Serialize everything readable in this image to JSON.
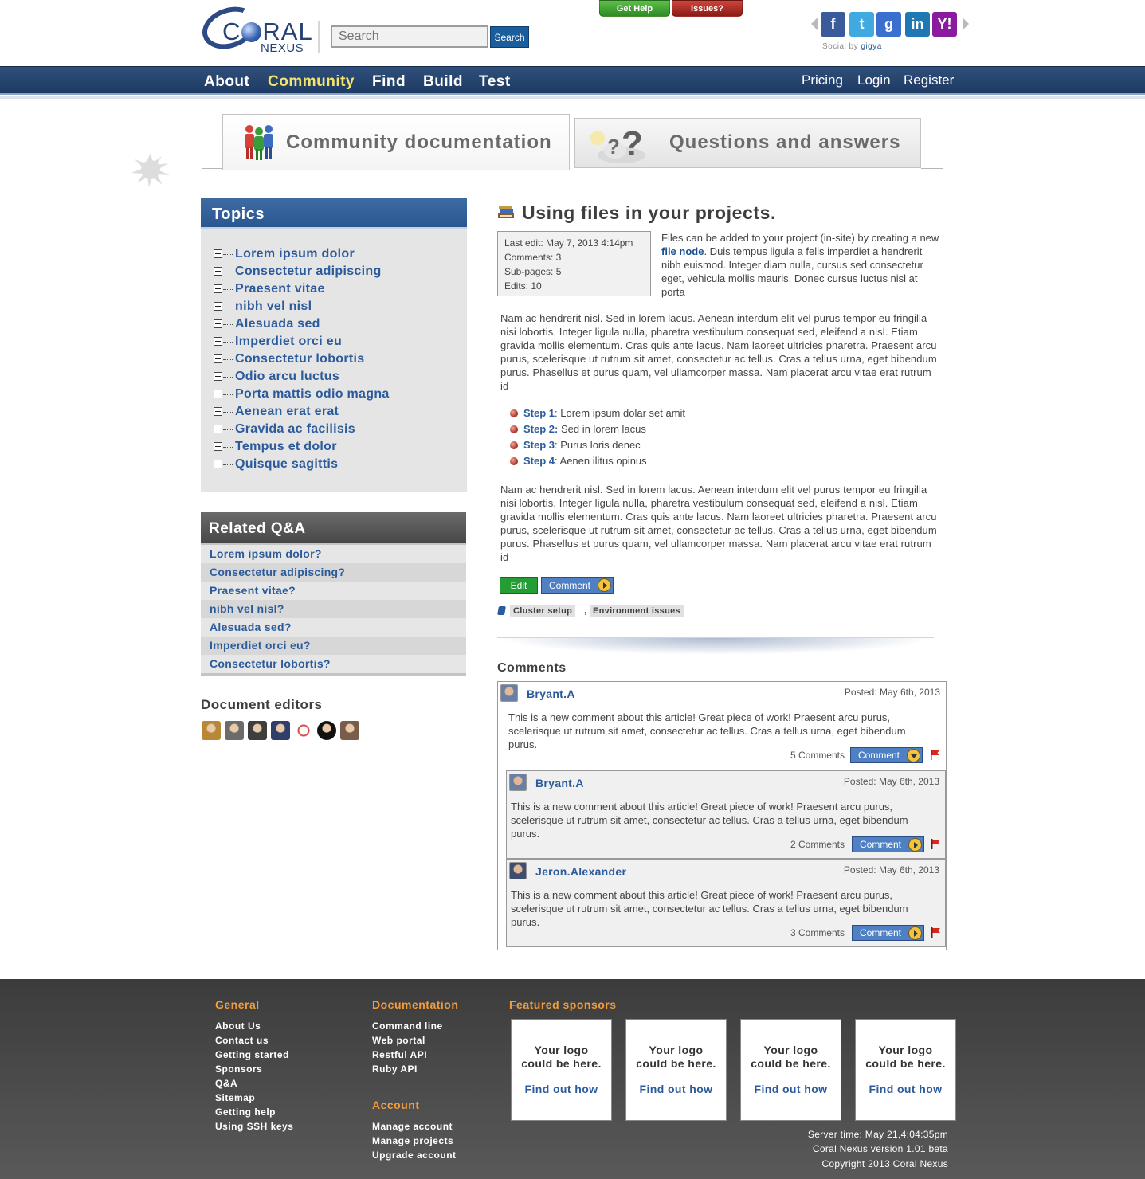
{
  "header": {
    "logo_word_a": "C",
    "logo_word_b": "RAL",
    "logo_sub": "NEXUS",
    "search_placeholder": "Search",
    "search_button": "Search",
    "get_help": "Get Help",
    "issues": "Issues?",
    "social_label": "Social by",
    "social_brand": "gigya",
    "social_icons": [
      "facebook-icon",
      "twitter-icon",
      "google-icon",
      "linkedin-icon",
      "yahoo-icon"
    ],
    "social_glyphs": [
      "f",
      "t",
      "g",
      "in",
      "Y!"
    ]
  },
  "nav": {
    "left": [
      "About",
      "Community",
      "Find",
      "Build",
      "Test"
    ],
    "active": "Community",
    "right": [
      "Pricing",
      "Login",
      "Register"
    ]
  },
  "tabs": {
    "doc": "Community documentation",
    "qa": "Questions and answers"
  },
  "topics": {
    "title": "Topics",
    "items": [
      "Lorem ipsum dolor",
      "Consectetur adipiscing",
      "Praesent vitae",
      "nibh vel nisl",
      "Alesuada sed",
      "Imperdiet orci eu",
      "Consectetur lobortis",
      "Odio arcu luctus",
      "Porta mattis odio magna",
      "Aenean erat erat",
      "Gravida ac facilisis",
      "Tempus et dolor",
      "Quisque sagittis"
    ]
  },
  "related": {
    "title": "Related Q&A",
    "items": [
      "Lorem ipsum dolor?",
      "Consectetur adipiscing?",
      "Praesent vitae?",
      "nibh vel nisl?",
      "Alesuada sed?",
      "Imperdiet orci eu?",
      "Consectetur lobortis?"
    ]
  },
  "editors": {
    "title": "Document editors",
    "colors": [
      "#b98836",
      "#6b6b6b",
      "#3e3e3e",
      "#2f3f6a",
      "#d84a4a",
      "#111111",
      "#7a5c4a"
    ]
  },
  "article": {
    "title": "Using files in your projects.",
    "meta": {
      "last_edit": "Last edit: May 7, 2013 4:14pm",
      "comments": "Comments: 3",
      "subpages": "Sub-pages: 5",
      "edits": "Edits: 10"
    },
    "intro_a": "Files can be added to your project (in-site) by creating a new ",
    "intro_link": "file node",
    "intro_b": ". Duis tempus ligula a felis imperdiet a hendrerit nibh euismod. Integer diam nulla, cursus sed consectetur eget, vehicula mollis mauris. Donec cursus luctus nisl at porta",
    "para1": "Nam ac hendrerit nisl. Sed in lorem lacus. Aenean interdum elit vel purus tempor eu fringilla nisi lobortis. Integer ligula nulla, pharetra vestibulum consequat sed, eleifend a nisl. Etiam gravida mollis elementum. Cras quis ante lacus. Nam laoreet ultricies pharetra. Praesent arcu purus, scelerisque ut rutrum sit amet, consectetur ac tellus. Cras a tellus urna, eget bibendum purus. Phasellus et purus quam, vel ullamcorper massa. Nam placerat arcu vitae erat rutrum id",
    "steps": [
      {
        "label": "Step 1",
        "text": ": Lorem ipsum dolar set amit"
      },
      {
        "label": "Step 2:",
        "text": " Sed in lorem lacus"
      },
      {
        "label": "Step 3",
        "text": ": Purus loris denec"
      },
      {
        "label": "Step 4",
        "text": ": Aenen ilitus opinus"
      }
    ],
    "para2": "Nam ac hendrerit nisl. Sed in lorem lacus. Aenean interdum elit vel purus tempor eu fringilla nisi lobortis. Integer ligula nulla, pharetra vestibulum consequat sed, eleifend a nisl. Etiam gravida mollis elementum. Cras quis ante lacus. Nam laoreet ultricies pharetra. Praesent arcu purus, scelerisque ut rutrum sit amet, consectetur ac tellus. Cras a tellus urna, eget bibendum purus. Phasellus et purus quam, vel ullamcorper massa. Nam placerat arcu vitae erat rutrum id",
    "edit_button": "Edit",
    "comment_button": "Comment",
    "tags": [
      "Cluster setup",
      "Environment issues"
    ],
    "tag_sep": ","
  },
  "comments": {
    "title": "Comments",
    "items": [
      {
        "author": "Bryant.A",
        "posted": "Posted: May 6th, 2013",
        "body": "This is a new comment about this article! Great piece of work! Praesent arcu purus, scelerisque ut rutrum sit amet, consectetur ac tellus. Cras a tellus urna, eget bibendum purus.",
        "count": "5 Comments",
        "button": "Comment"
      },
      {
        "author": "Bryant.A",
        "posted": "Posted: May 6th, 2013",
        "body": "This is a new comment about this article! Great piece of work! Praesent arcu purus, scelerisque ut rutrum sit amet, consectetur ac tellus. Cras a tellus urna, eget bibendum purus.",
        "count": "2 Comments",
        "button": "Comment"
      },
      {
        "author": "Jeron.Alexander",
        "posted": "Posted: May 6th, 2013",
        "body": "This is a new comment about this article! Great piece of work! Praesent arcu purus, scelerisque ut rutrum sit amet, consectetur ac tellus. Cras a tellus urna, eget bibendum purus.",
        "count": "3 Comments",
        "button": "Comment"
      }
    ]
  },
  "footer": {
    "general_title": "General",
    "general": [
      "About Us",
      "Contact us",
      "Getting started",
      "Sponsors",
      "Q&A",
      "Sitemap",
      "Getting help",
      "Using SSH keys"
    ],
    "doc_title": "Documentation",
    "documentation": [
      "Command line",
      "Web portal",
      "Restful API",
      "Ruby API"
    ],
    "account_title": "Account",
    "account": [
      "Manage account",
      "Manage projects",
      "Upgrade account"
    ],
    "sponsors_title": "Featured sponsors",
    "sponsor_line1": "Your logo",
    "sponsor_line2": "could be here.",
    "sponsor_link": "Find out how",
    "server_time": "Server time: May 21,4:04:35pm",
    "version": "Coral Nexus version 1.01 beta",
    "copyright": "Copyright 2013 Coral Nexus"
  },
  "colors": {
    "nav_bg": "#2f4f7a",
    "nav_active": "#f5e66a",
    "link": "#2c5b9c",
    "footer_head": "#f19c3d",
    "edit_green": "#239d34"
  }
}
